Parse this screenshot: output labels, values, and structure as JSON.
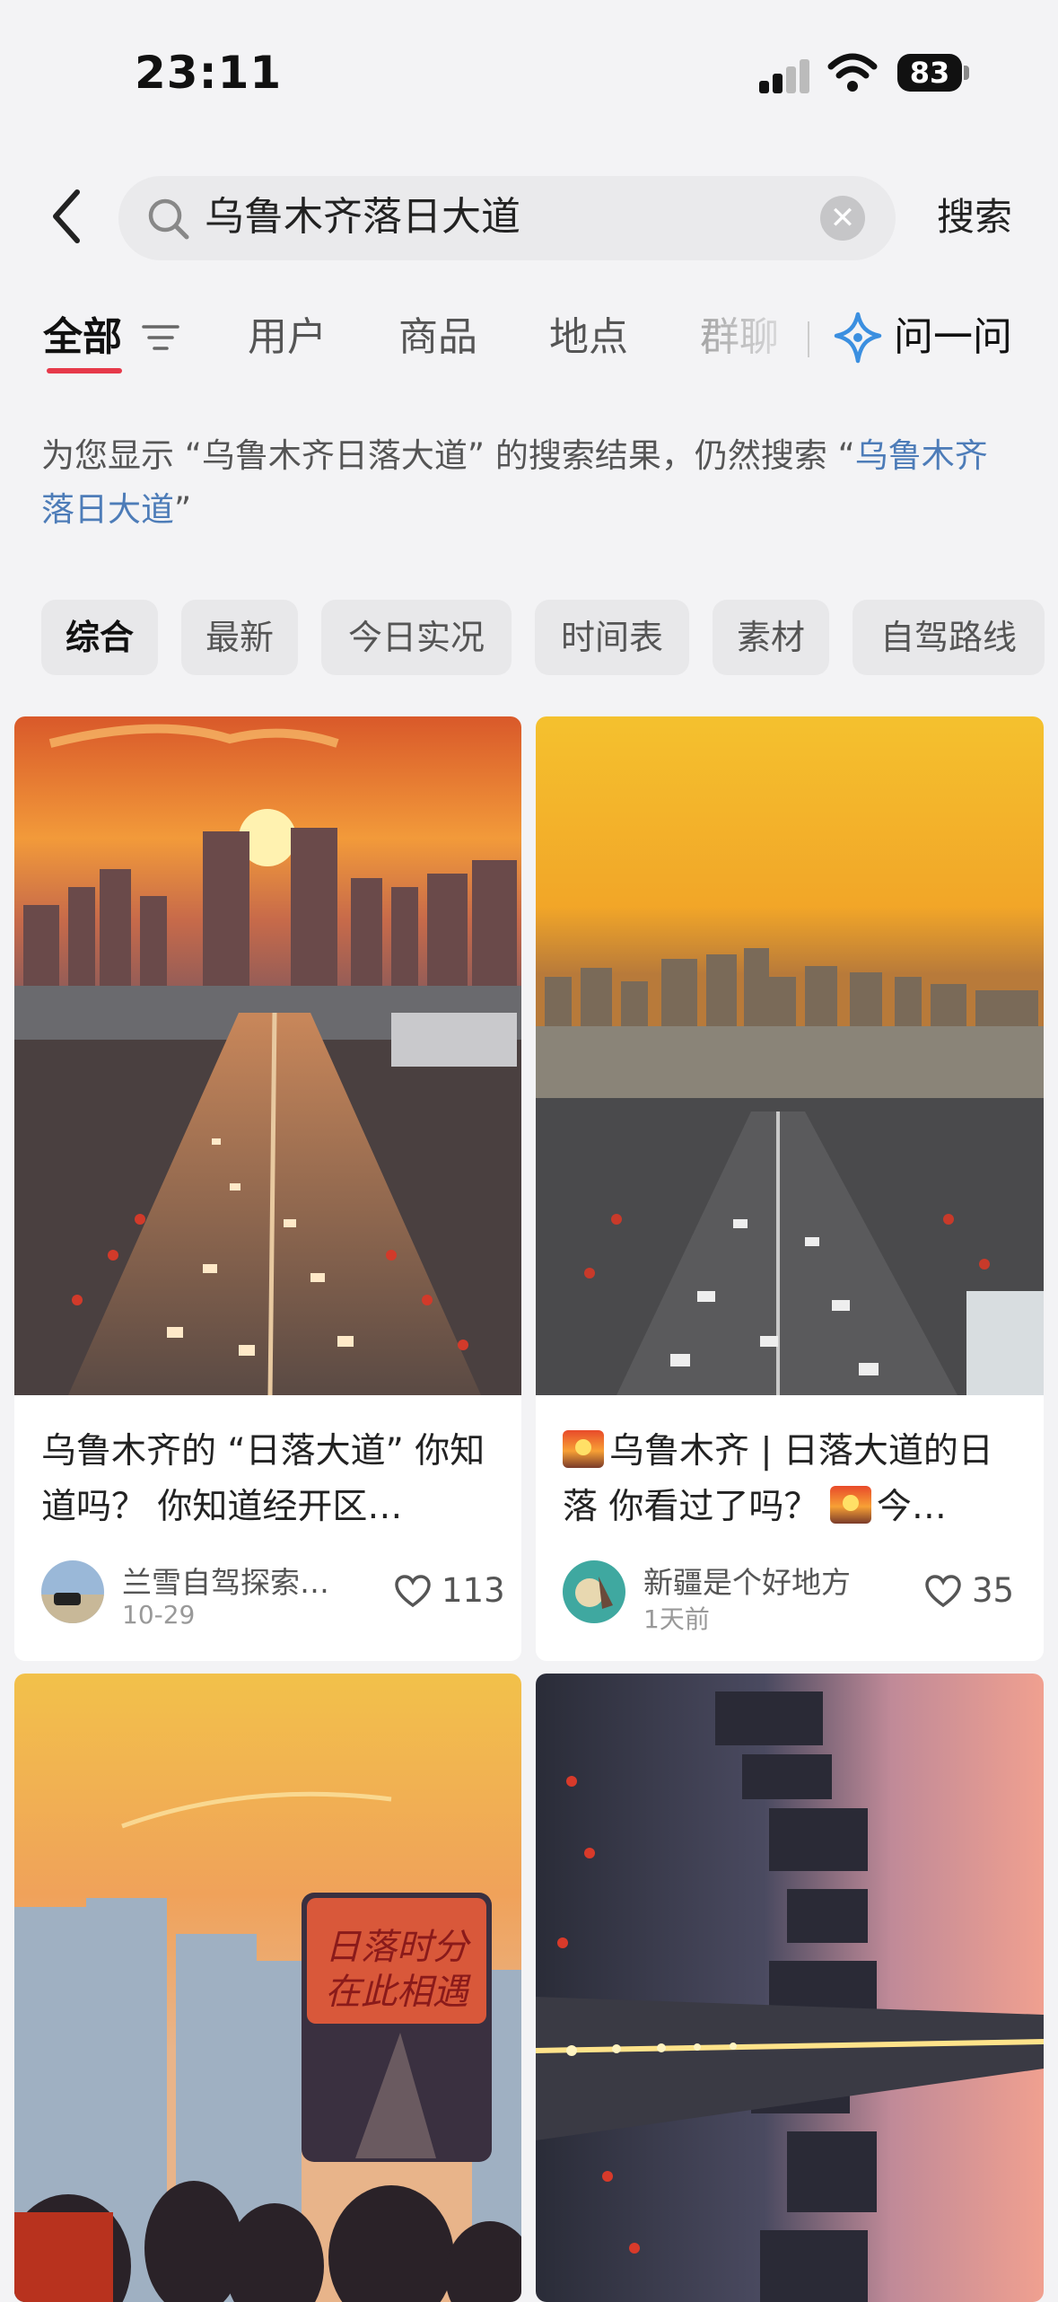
{
  "status_bar": {
    "time": "23:11",
    "battery": "83"
  },
  "search": {
    "query": "乌鲁木齐落日大道",
    "button_label": "搜索"
  },
  "tabs": [
    {
      "label": "全部"
    },
    {
      "label": "用户"
    },
    {
      "label": "商品"
    },
    {
      "label": "地点"
    },
    {
      "label": "群聊"
    }
  ],
  "ask": {
    "label": "问一问"
  },
  "notice": {
    "prefix": "为您显示 “乌鲁木齐日落大道” 的搜索结果，仍然搜索 “",
    "link": "乌鲁木齐落日大道",
    "suffix": "”"
  },
  "chips": [
    "综合",
    "最新",
    "今日实况",
    "时间表",
    "素材",
    "自驾路线"
  ],
  "cards": [
    {
      "title": "乌鲁木齐的 “日落大道” 你知道吗？ 你知道经开区…",
      "author": "兰雪自驾探索…",
      "date": "10-29",
      "likes": "113"
    },
    {
      "title_part1": "乌鲁木齐 | 日落大道的日落 你看过了吗？",
      "title_part2": "今…",
      "author": "新疆是个好地方",
      "date": "1天前",
      "likes": "35"
    },
    {
      "overlay_text_line1": "日落时分",
      "overlay_text_line2": "在此相遇"
    },
    {}
  ],
  "colors": {
    "accent": "#e6394a",
    "link": "#4d7cb8",
    "background": "#f3f3f5"
  }
}
